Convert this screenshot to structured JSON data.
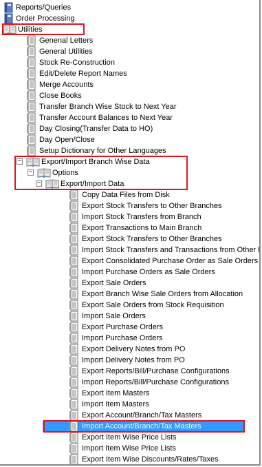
{
  "tree": {
    "items": [
      {
        "label": "Reports/Queries",
        "level": 0,
        "node": "book",
        "expand": "+"
      },
      {
        "label": "Order Processing",
        "level": 0,
        "node": "book",
        "expand": "+"
      },
      {
        "label": "Utilities",
        "level": 0,
        "node": "book-open",
        "expand": "-"
      },
      {
        "label": "Genenal Letters",
        "level": 1,
        "node": "doc"
      },
      {
        "label": "General Utilities",
        "level": 1,
        "node": "doc"
      },
      {
        "label": "Stock Re-Construction",
        "level": 1,
        "node": "doc"
      },
      {
        "label": "Edit/Delete Report Names",
        "level": 1,
        "node": "doc"
      },
      {
        "label": "Merge Accounts",
        "level": 1,
        "node": "doc"
      },
      {
        "label": "Close Books",
        "level": 1,
        "node": "doc"
      },
      {
        "label": "Transfer Branch Wise Stock to Next Year",
        "level": 1,
        "node": "doc"
      },
      {
        "label": "Transfer Account Balances to Next Year",
        "level": 1,
        "node": "doc"
      },
      {
        "label": "Day Closing(Transfer Data to HO)",
        "level": 1,
        "node": "doc"
      },
      {
        "label": "Day Open/Close",
        "level": 1,
        "node": "doc"
      },
      {
        "label": "Setup Dictionary for Other Languages",
        "level": 1,
        "node": "doc"
      },
      {
        "label": "Export/Import Branch Wise Data",
        "level": 1,
        "node": "book-open",
        "expand": "-"
      },
      {
        "label": "Options",
        "level": 2,
        "node": "book-open",
        "expand": "-"
      },
      {
        "label": "Export/Import Data",
        "level": 3,
        "node": "book-open",
        "expand": "-"
      },
      {
        "label": "Copy Data Files from Disk",
        "level": 4,
        "node": "doc"
      },
      {
        "label": "Export Stock Transfers to Other Branches",
        "level": 4,
        "node": "doc"
      },
      {
        "label": "Import Stock Transfers from Branch",
        "level": 4,
        "node": "doc"
      },
      {
        "label": "Export Transactions to Main Branch",
        "level": 4,
        "node": "doc"
      },
      {
        "label": "Export Stock Transfers to Other Branches",
        "level": 4,
        "node": "doc"
      },
      {
        "label": "Import Stock Transfers and Transactions from Other Branch",
        "level": 4,
        "node": "doc"
      },
      {
        "label": "Export Consolidated Purchase Order as Sale Orders",
        "level": 4,
        "node": "doc"
      },
      {
        "label": "Import Purchase Orders as Sale Orders",
        "level": 4,
        "node": "doc"
      },
      {
        "label": "Export Sale Orders",
        "level": 4,
        "node": "doc"
      },
      {
        "label": "Export Branch Wise Sale Orders from Allocation",
        "level": 4,
        "node": "doc"
      },
      {
        "label": "Export Sale Orders from Stock Requisition",
        "level": 4,
        "node": "doc"
      },
      {
        "label": "Import Sale Orders",
        "level": 4,
        "node": "doc"
      },
      {
        "label": "Export Purchase Orders",
        "level": 4,
        "node": "doc"
      },
      {
        "label": "Import Purchase Orders",
        "level": 4,
        "node": "doc"
      },
      {
        "label": "Export Delivery Notes from PO",
        "level": 4,
        "node": "doc"
      },
      {
        "label": "Import Delivery Notes from PO",
        "level": 4,
        "node": "doc"
      },
      {
        "label": "Export Reports/Bill/Purchase Configurations",
        "level": 4,
        "node": "doc"
      },
      {
        "label": "Import Reports/Bill/Purchase Configurations",
        "level": 4,
        "node": "doc"
      },
      {
        "label": "Export Item Masters",
        "level": 4,
        "node": "doc"
      },
      {
        "label": "Import Item Masters",
        "level": 4,
        "node": "doc"
      },
      {
        "label": "Export Account/Branch/Tax Masters",
        "level": 4,
        "node": "doc"
      },
      {
        "label": "Import Account/Branch/Tax Masters",
        "level": 4,
        "node": "doc",
        "selected": true
      },
      {
        "label": "Export Item Wise Price Lists",
        "level": 4,
        "node": "doc"
      },
      {
        "label": "Import Item Wise Price Lists",
        "level": 4,
        "node": "doc"
      },
      {
        "label": "Export Item Wise Discounts/Rates/Taxes",
        "level": 4,
        "node": "doc"
      }
    ]
  },
  "colors": {
    "selection": "#3399ff",
    "highlight_box": "#e0151c",
    "book_cover": "#5b7fc8",
    "doc": "#6b6b6b"
  }
}
